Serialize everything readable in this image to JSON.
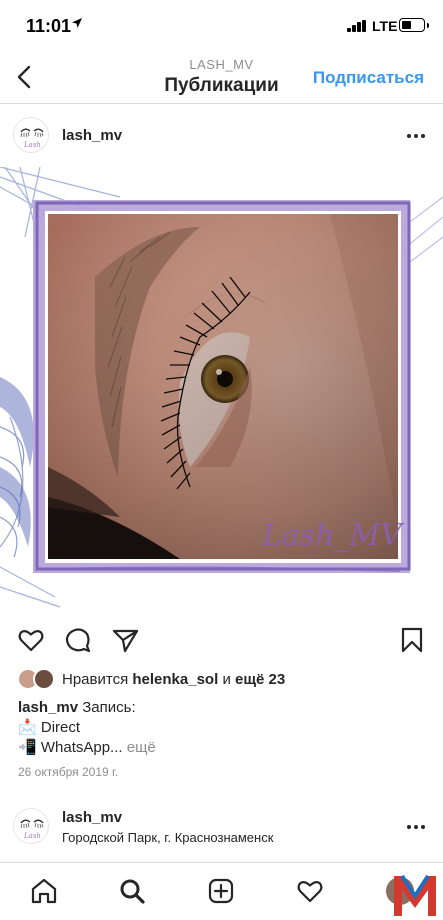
{
  "status": {
    "time": "11:01",
    "network": "LTE",
    "battery_level": 0.4
  },
  "nav": {
    "subtitle": "LASH_MV",
    "title": "Публикации",
    "follow_label": "Подписаться"
  },
  "post": {
    "username": "lash_mv",
    "image_signature": "Lash_MV",
    "likes": {
      "prefix": "Нравится",
      "user": "helenka_sol",
      "joiner": "и",
      "others": "ещё 23"
    },
    "caption": {
      "username": "lash_mv",
      "text": "Запись:",
      "line2_emoji": "📩",
      "line2_text": "Direct",
      "line3_emoji": "📲",
      "line3_text": "WhatsApp...",
      "more": "ещё"
    },
    "date": "26 октября 2019 г."
  },
  "next_post": {
    "username": "lash_mv",
    "location": "Городской Парк, г. Краснознаменск"
  },
  "tabbar": [
    "home-icon",
    "search-icon",
    "new-post-icon",
    "activity-icon",
    "profile-avatar"
  ],
  "colors": {
    "link_blue": "#3897f0",
    "frame_purple": "#8d74c0",
    "text_dark": "#262626",
    "text_grey": "#8e8e8e"
  }
}
